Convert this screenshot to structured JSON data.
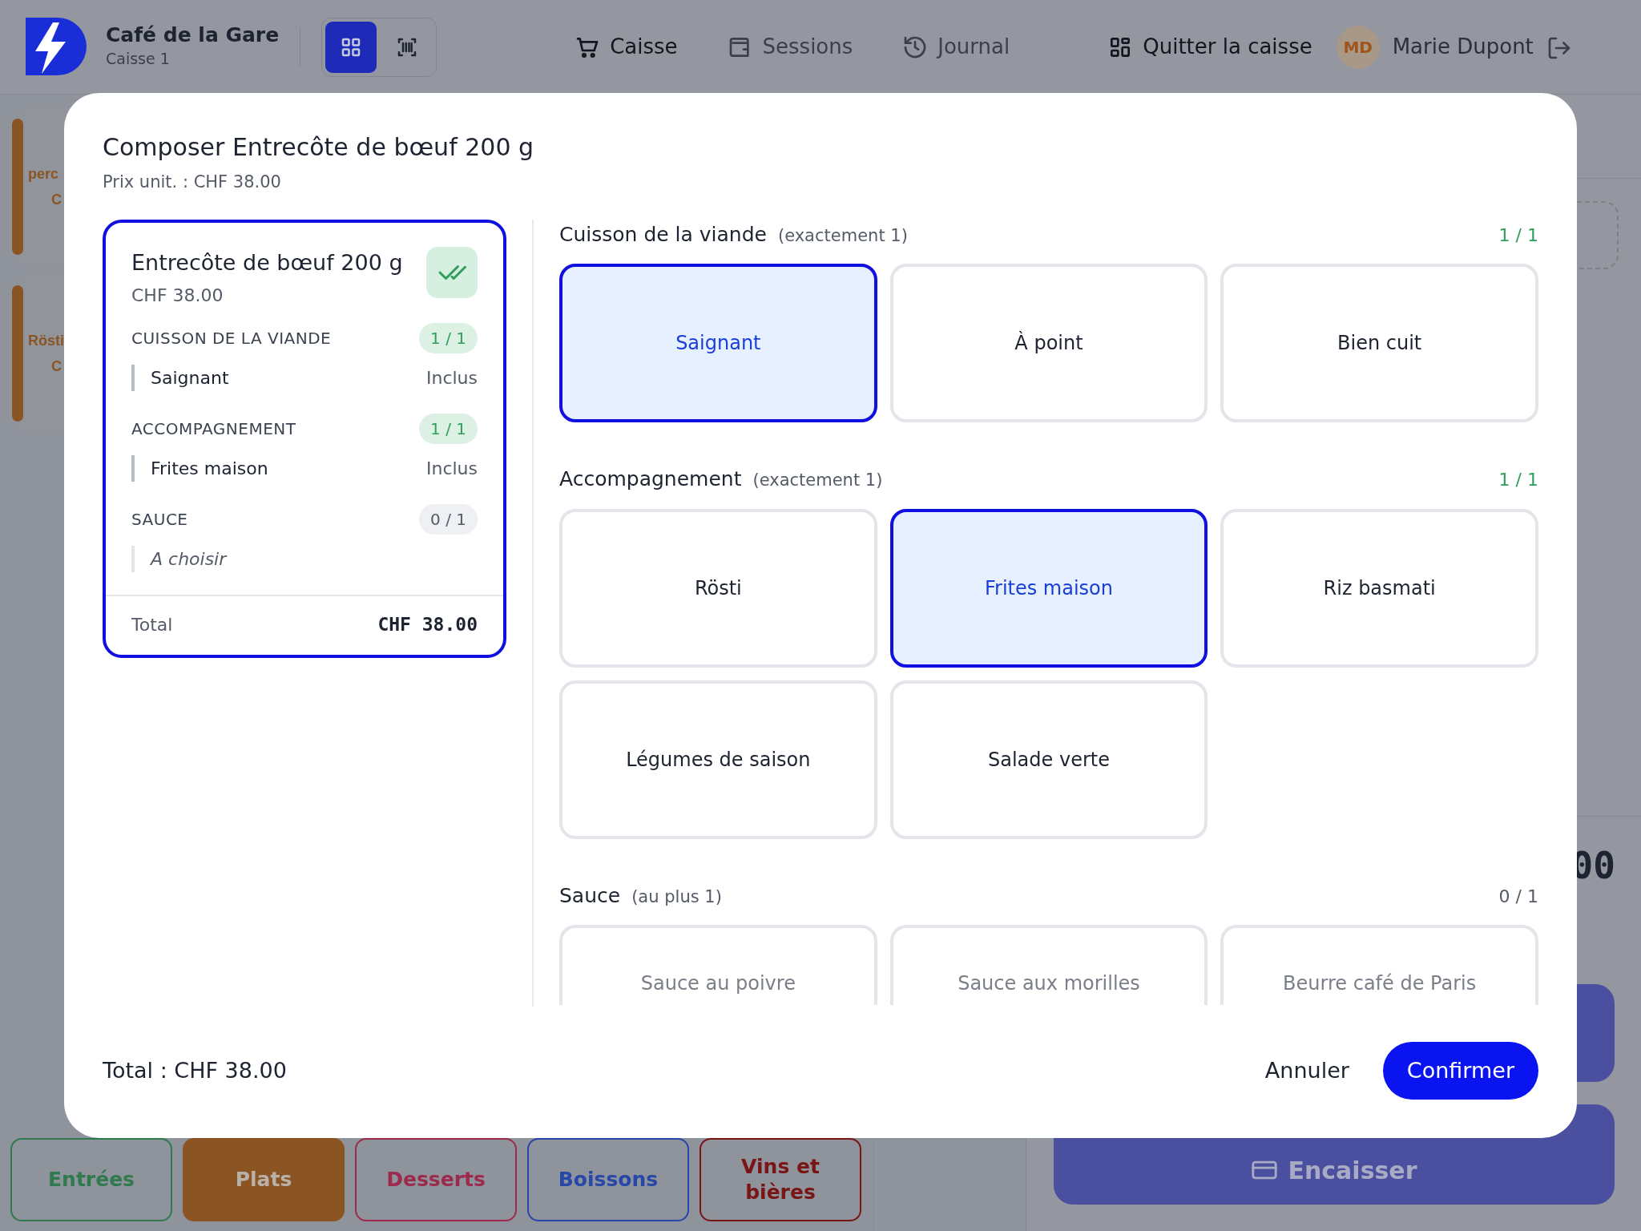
{
  "header": {
    "brand": "Café de la Gare",
    "register": "Caisse 1",
    "view_modes": [
      {
        "kind": "grid",
        "selected": true
      },
      {
        "kind": "scan",
        "selected": false
      }
    ],
    "nav": [
      {
        "label": "Caisse",
        "selected": true
      },
      {
        "label": "Sessions",
        "selected": false
      },
      {
        "label": "Journal",
        "selected": false
      }
    ],
    "exit": "Quitter la caisse",
    "user": {
      "initials": "MD",
      "name": "Marie Dupont"
    }
  },
  "products": [
    {
      "name": "perc",
      "price": "C",
      "color": "#8b5523"
    },
    {
      "name": "Rösti",
      "price": "C",
      "color": "#8b5523"
    }
  ],
  "order_panel": {
    "total": "00",
    "action": "Encaisser"
  },
  "categories": [
    {
      "label": "Entrées",
      "color": "#2f7a4e",
      "selected": false
    },
    {
      "label": "Plats",
      "color": "#8b5523",
      "selected": true
    },
    {
      "label": "Desserts",
      "color": "#9c2a4c",
      "selected": false
    },
    {
      "label": "Boissons",
      "color": "#2748a8",
      "selected": false
    },
    {
      "label": "Vins et bières",
      "color": "#7a1515",
      "selected": false
    }
  ],
  "modal": {
    "title": "Composer Entrecôte de bœuf 200 g",
    "subtitle": "Prix unit. : CHF 38.00",
    "summary": {
      "name": "Entrecôte de bœuf 200 g",
      "price": "CHF 38.00",
      "complete": true,
      "groups": [
        {
          "name": "CUISSON DE LA VIANDE",
          "count": "1 / 1",
          "complete": true,
          "items": [
            {
              "label": "Saignant",
              "price": "Inclus",
              "pending": false
            }
          ]
        },
        {
          "name": "ACCOMPAGNEMENT",
          "count": "1 / 1",
          "complete": true,
          "items": [
            {
              "label": "Frites maison",
              "price": "Inclus",
              "pending": false
            }
          ]
        },
        {
          "name": "SAUCE",
          "count": "0 / 1",
          "complete": false,
          "items": [
            {
              "label": "A choisir",
              "pending": true
            }
          ]
        }
      ],
      "total_label": "Total",
      "total": "CHF 38.00"
    },
    "groups": [
      {
        "name": "Cuisson de la viande",
        "rule": "(exactement 1)",
        "count": "1 / 1",
        "complete": true,
        "options": [
          {
            "label": "Saignant",
            "selected": true
          },
          {
            "label": "À point",
            "selected": false
          },
          {
            "label": "Bien cuit",
            "selected": false
          }
        ]
      },
      {
        "name": "Accompagnement",
        "rule": "(exactement 1)",
        "count": "1 / 1",
        "complete": true,
        "options": [
          {
            "label": "Rösti",
            "selected": false
          },
          {
            "label": "Frites maison",
            "selected": true
          },
          {
            "label": "Riz basmati",
            "selected": false
          },
          {
            "label": "Légumes de saison",
            "selected": false
          },
          {
            "label": "Salade verte",
            "selected": false
          }
        ]
      },
      {
        "name": "Sauce",
        "rule": "(au plus 1)",
        "count": "0 / 1",
        "complete": false,
        "options": [
          {
            "label": "Sauce au poivre",
            "selected": false
          },
          {
            "label": "Sauce aux morilles",
            "selected": false
          },
          {
            "label": "Beurre café de Paris",
            "selected": false
          }
        ]
      }
    ],
    "footer_total": "Total : CHF 38.00",
    "cancel": "Annuler",
    "confirm": "Confirmer"
  }
}
